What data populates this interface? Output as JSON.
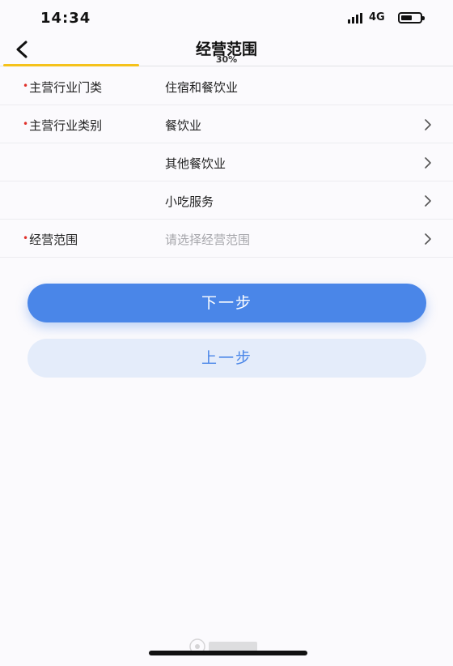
{
  "status_bar": {
    "time": "14:34",
    "network": "4G",
    "icons": [
      "signal-icon",
      "battery-icon"
    ]
  },
  "nav": {
    "title": "经营范围",
    "progress_text": "30%",
    "progress": 0.3,
    "back_icon": "chevron-left-icon",
    "accent_color": "#f5c21b"
  },
  "form": {
    "rows": [
      {
        "label": "主营行业门类",
        "required": true,
        "value": "住宿和餐饮业",
        "has_chevron": false
      },
      {
        "label": "主营行业类别",
        "required": true,
        "value": "餐饮业",
        "has_chevron": true
      },
      {
        "label": "",
        "required": false,
        "value": "其他餐饮业",
        "has_chevron": true
      },
      {
        "label": "",
        "required": false,
        "value": "小吃服务",
        "has_chevron": true
      },
      {
        "label": "经营范围",
        "required": true,
        "placeholder": "请选择经营范围",
        "has_chevron": true
      }
    ],
    "required_color": "#e0302a"
  },
  "actions": {
    "next_label": "下一步",
    "prev_label": "上一步",
    "primary_color": "#4a86e8"
  }
}
